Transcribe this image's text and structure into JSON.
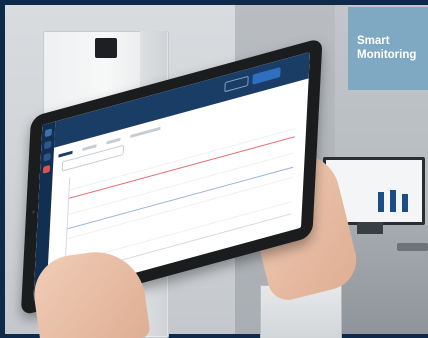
{
  "badge": {
    "text": "Smart\nMonitoring",
    "background": "#7fa9c2",
    "text_color": "#ffffff"
  },
  "colors": {
    "frame": "#0d2a4a",
    "app_header": "#1a3d66",
    "app_sidebar": "#122f52",
    "limit_line": "#e36b6b"
  }
}
